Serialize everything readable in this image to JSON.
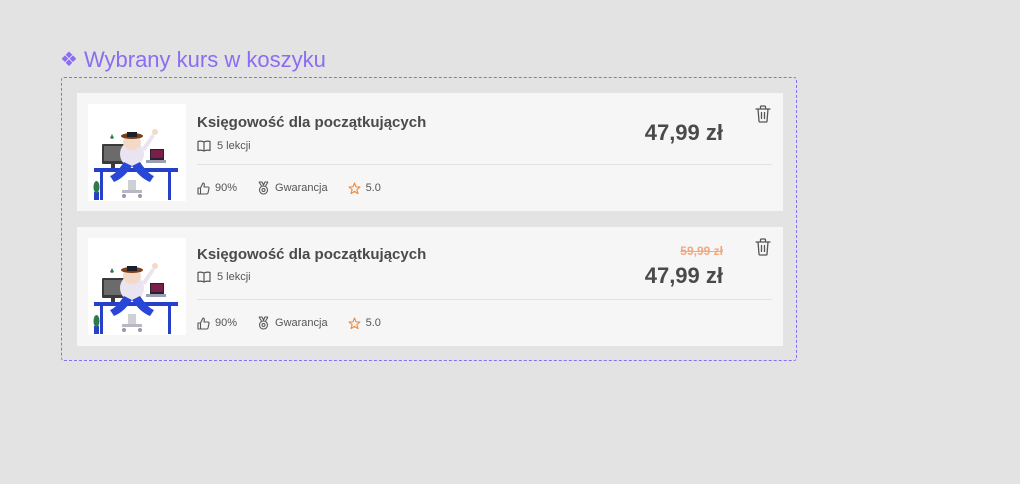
{
  "section": {
    "title": "Wybrany kurs w koszyku",
    "icon": "component-diamond-icon"
  },
  "colors": {
    "accent": "#8b6cf2",
    "old_price": "#f4a77e",
    "star": "#f08a3c",
    "background": "#e3e3e3",
    "card": "#f6f6f6"
  },
  "items": [
    {
      "title": "Księgowość dla początkujących",
      "lessons": "5 lekcji",
      "likes": "90%",
      "guarantee": "Gwarancja",
      "rating": "5.0",
      "price": "47,99 zł",
      "old_price": null
    },
    {
      "title": "Księgowość dla początkujących",
      "lessons": "5 lekcji",
      "likes": "90%",
      "guarantee": "Gwarancja",
      "rating": "5.0",
      "price": "47,99 zł",
      "old_price": "59,99 zł"
    }
  ]
}
